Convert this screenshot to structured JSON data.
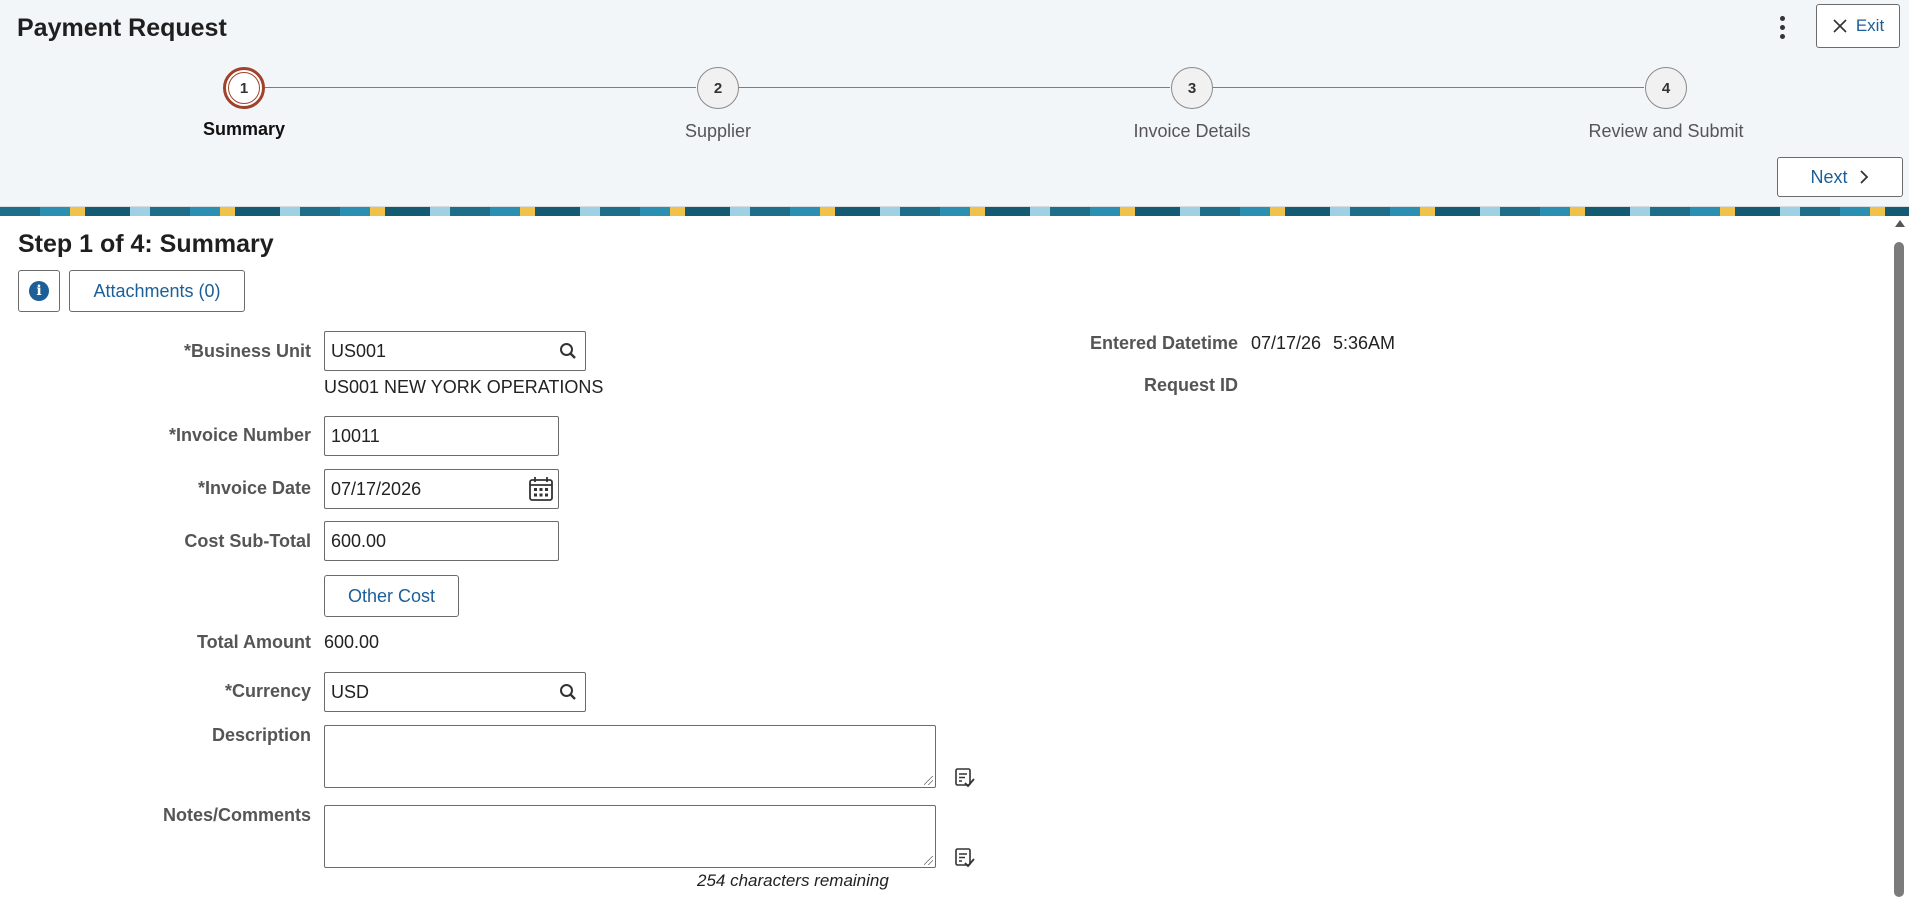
{
  "header": {
    "title": "Payment Request",
    "exit_label": "Exit",
    "next_label": "Next",
    "steps": [
      {
        "number": "1",
        "label": "Summary",
        "active": true
      },
      {
        "number": "2",
        "label": "Supplier",
        "active": false
      },
      {
        "number": "3",
        "label": "Invoice Details",
        "active": false
      },
      {
        "number": "4",
        "label": "Review and Submit",
        "active": false
      }
    ]
  },
  "page": {
    "heading": "Step 1 of 4: Summary",
    "attachments_label": "Attachments (0)"
  },
  "form": {
    "business_unit": {
      "label": "*Business Unit",
      "value": "US001",
      "description": "US001 NEW YORK OPERATIONS"
    },
    "invoice_number": {
      "label": "*Invoice Number",
      "value": "10011"
    },
    "invoice_date": {
      "label": "*Invoice Date",
      "value": "07/17/2026"
    },
    "cost_subtotal": {
      "label": "Cost Sub-Total",
      "value": "600.00"
    },
    "other_cost_label": "Other Cost",
    "total_amount": {
      "label": "Total Amount",
      "value": "600.00"
    },
    "currency": {
      "label": "*Currency",
      "value": "USD"
    },
    "description": {
      "label": "Description",
      "value": ""
    },
    "notes": {
      "label": "Notes/Comments",
      "value": "",
      "remaining": "254 characters remaining"
    },
    "entered_datetime": {
      "label": "Entered Datetime",
      "date": "07/17/26",
      "time": "5:36AM"
    },
    "request_id": {
      "label": "Request ID",
      "value": ""
    }
  },
  "icons": {
    "kebab": "more-vertical-icon",
    "exit": "close-icon",
    "next": "chevron-right-icon",
    "info": "info-icon",
    "lookup": "search-icon",
    "calendar": "calendar-icon",
    "spellcheck": "spell-check-icon"
  },
  "colors": {
    "link": "#1b5e98",
    "active_step": "#a0422a",
    "header_bg": "#f3f6f9"
  }
}
